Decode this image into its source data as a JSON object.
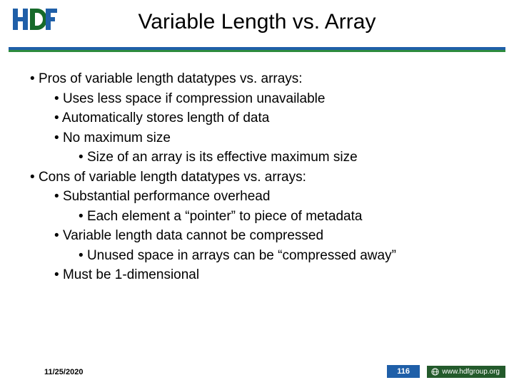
{
  "header": {
    "title": "Variable Length vs. Array"
  },
  "bullets": {
    "pros_heading": "Pros of variable length datatypes vs. arrays:",
    "pros": {
      "p1": "Uses less space if compression unavailable",
      "p2": "Automatically stores length of data",
      "p3": "No maximum size",
      "p3_sub": "Size of an array is its effective maximum size"
    },
    "cons_heading": "Cons of variable length datatypes vs. arrays:",
    "cons": {
      "c1": "Substantial performance overhead",
      "c1_sub": "Each element a “pointer” to piece of metadata",
      "c2": "Variable length data cannot be compressed",
      "c2_sub": "Unused space in arrays can be “compressed away”",
      "c3": "Must be 1-dimensional"
    }
  },
  "footer": {
    "date": "11/25/2020",
    "page": "116",
    "url": "www.hdfgroup.org"
  },
  "colors": {
    "blue": "#1f5fa8",
    "green": "#2e8b3d",
    "darkgreen": "#235a2b"
  }
}
